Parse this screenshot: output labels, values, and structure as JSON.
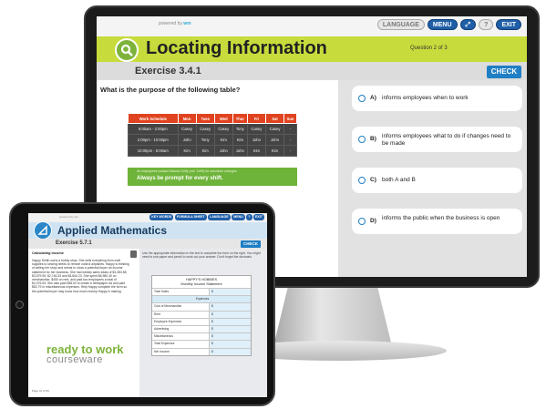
{
  "desktop": {
    "powered_by": "powered by",
    "powered_brand": "wın",
    "toolbar": {
      "language": "LANGUAGE",
      "menu": "MENU",
      "help": "?",
      "exit": "EXIT"
    },
    "module_title": "Locating Information",
    "question_counter": "Question 2 of 3",
    "exercise": "Exercise 3.4.1",
    "check_label": "CHECK",
    "prompt": "What is the purpose of the following table?",
    "schedule": {
      "headers": [
        "Work Schedule",
        "Mon",
        "Tues",
        "Wed",
        "Thur",
        "Fri",
        "Sat",
        "Sun"
      ],
      "rows": [
        [
          "6:00am - 2:00pm",
          "Casey",
          "Casey",
          "Casey",
          "Tony",
          "Casey",
          "Casey",
          "-"
        ],
        [
          "2:00pm - 10:00pm",
          "John",
          "Tony",
          "Kim",
          "Kim",
          "John",
          "John",
          "-"
        ],
        [
          "10:00pm - 6:00am",
          "Kim",
          "Kim",
          "John",
          "John",
          "Kim",
          "Kim",
          "-"
        ]
      ],
      "note": "All employees contact Wanda Duffy (ext. 1195) for schedule changes.",
      "note_bold": "Always be prompt for every shift."
    },
    "answers": [
      {
        "letter": "A)",
        "text": "informs employees when to work"
      },
      {
        "letter": "B)",
        "text": "informs employees what to do if changes need to be made"
      },
      {
        "letter": "C)",
        "text": "both A and B"
      },
      {
        "letter": "D)",
        "text": "informs the public when the business is open"
      }
    ],
    "colors": {
      "title_bar": "#c7dc3c",
      "check": "#1f7fc4",
      "schedule_header": "#e0431f",
      "schedule_footer": "#6fb43a"
    }
  },
  "tablet": {
    "powered_by": "powered by wın",
    "toolbar": [
      "KEY WORDS",
      "FORMULA SHEET",
      "LANGUAGE",
      "MENU",
      "?",
      "EXIT"
    ],
    "module_title": "Applied Mathematics",
    "exercise": "Exercise 5.7.1",
    "check_label": "CHECK",
    "context_heading": "Calculating Income",
    "paragraph": "Happy Smith owns a hobby shop. She sells everything from craft supplies to sewing needs to remote control airplanes. Happy is thinking of selling her shop and needs to show a potential buyer an income statement for her business. She had weekly sales totals of $3,384.58, $3,579.95, $2,746.33 and $4,664.23. She spent $6,980.30 on merchandise, $450 on rent, and paid two employees a total of $4,376.53. She also paid $38.00 to create a newspaper ad and paid $52.79 in miscellaneous expenses. Help Happy complete the form so the potential buyer may know how much money Happy is making.",
    "instructions": "Use the appropriate information in the text to complete the form on the right. You might need to use paper and pencil to work out your answer. Don't forget the decimals.",
    "form_title_1": "HAPPY'S HOBBIES",
    "form_title_2": "Monthly Income Statement",
    "form_rows": [
      {
        "label": "Total Sales",
        "value": "$"
      },
      {
        "label": "Expenses",
        "value": "",
        "section": true
      },
      {
        "label": "Cost of Merchandise",
        "value": "$"
      },
      {
        "label": "Rent",
        "value": "$"
      },
      {
        "label": "Employee Expenses",
        "value": "$"
      },
      {
        "label": "Advertising",
        "value": "$"
      },
      {
        "label": "Miscellaneous",
        "value": "$"
      },
      {
        "label": "Total Expenses",
        "value": "$"
      },
      {
        "label": "Net Income",
        "value": "$"
      }
    ],
    "brand_line1": "ready to work",
    "brand_line2": "courseware",
    "page_indicator": "Page 31 of 50"
  }
}
